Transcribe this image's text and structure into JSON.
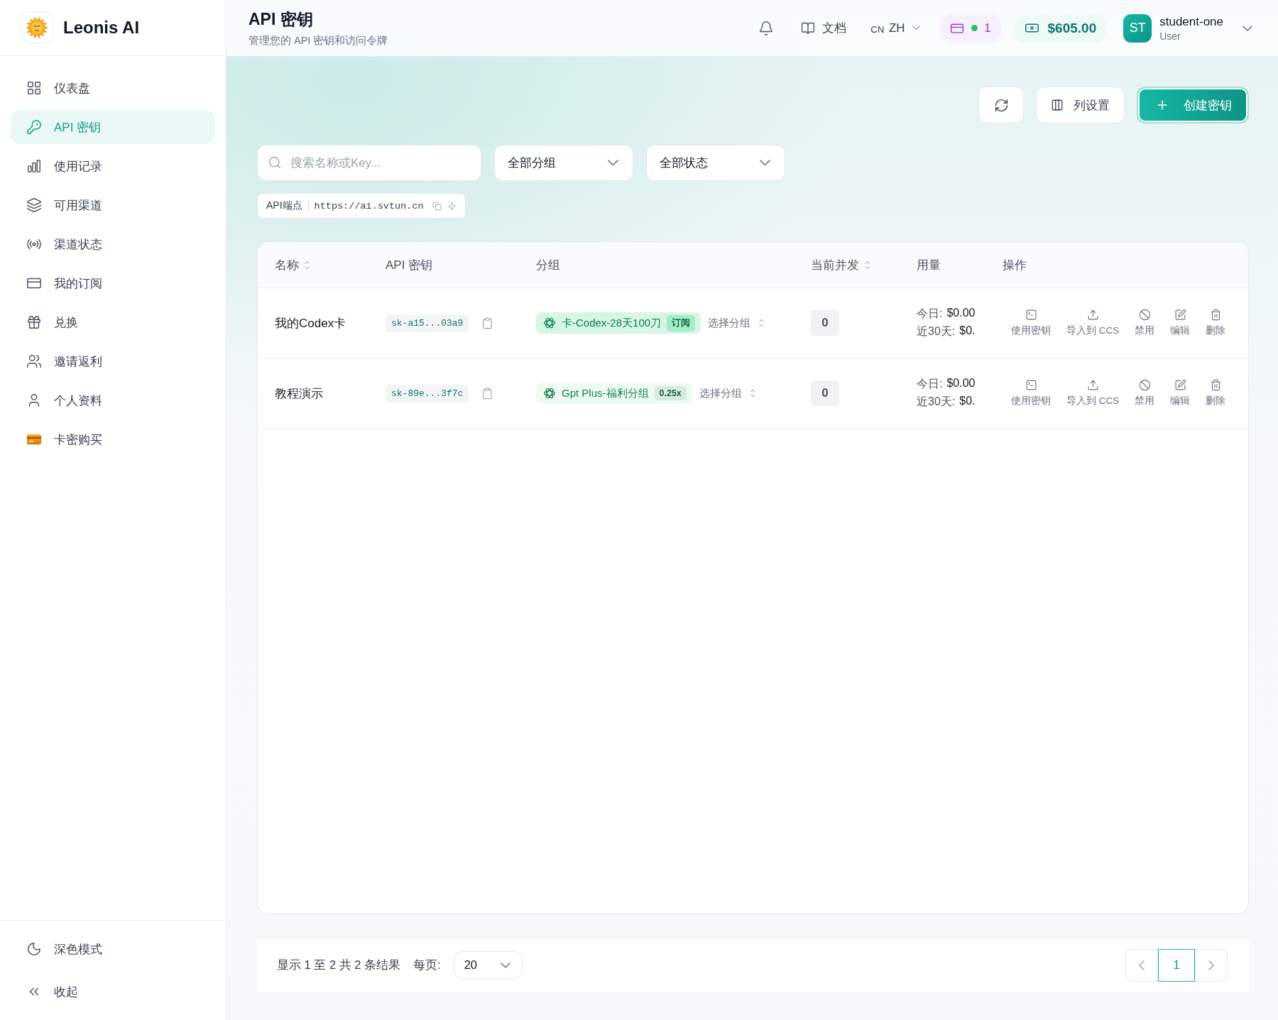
{
  "brand": {
    "name": "Leonis AI"
  },
  "sidebar": {
    "items": [
      {
        "label": "仪表盘",
        "selected": false
      },
      {
        "label": "API 密钥",
        "selected": true
      },
      {
        "label": "使用记录",
        "selected": false
      },
      {
        "label": "可用渠道",
        "selected": false
      },
      {
        "label": "渠道状态",
        "selected": false
      },
      {
        "label": "我的订阅",
        "selected": false
      },
      {
        "label": "兑换",
        "selected": false
      },
      {
        "label": "邀请返利",
        "selected": false
      },
      {
        "label": "个人资料",
        "selected": false
      },
      {
        "label": "卡密购买",
        "selected": false
      }
    ],
    "footer_items": [
      {
        "label": "深色模式"
      },
      {
        "label": "收起"
      }
    ]
  },
  "header": {
    "title": "API 密钥",
    "subtitle": "管理您的 API 密钥和访问令牌",
    "docs": "文档",
    "language": {
      "region": "CN",
      "code": "ZH"
    },
    "subscriptions": "1",
    "balance": "$605.00",
    "user": {
      "initials": "ST",
      "name": "student-one",
      "role": "User"
    }
  },
  "toolbar": {
    "columns_button": "列设置",
    "create_button": "创建密钥"
  },
  "filters": {
    "search": {
      "placeholder": "搜索名称或Key..."
    },
    "group": "全部分组",
    "status": "全部状态"
  },
  "endpoint": {
    "label": "API端点",
    "url": "https://ai.svtun.cn"
  },
  "table": {
    "columns": [
      {
        "label": "名称",
        "sortable": true
      },
      {
        "label": "API 密钥",
        "sortable": false
      },
      {
        "label": "分组",
        "sortable": false
      },
      {
        "label": "当前并发",
        "sortable": true
      },
      {
        "label": "用量",
        "sortable": false
      },
      {
        "label": "操作",
        "sortable": false
      }
    ],
    "rows": [
      {
        "name": "我的Codex卡",
        "key": "sk-a15...03a9",
        "group": {
          "kind": "subscription",
          "name": "卡-Codex-28天100刀",
          "badge": "订阅"
        },
        "group_select": "选择分组",
        "concurrency": "0",
        "usage": [
          {
            "label": "今日:",
            "value": "$0.00"
          },
          {
            "label": "近30天:",
            "value": "$0."
          }
        ],
        "actions": [
          "使用密钥",
          "导入到 CCS",
          "禁用",
          "编辑",
          "删除"
        ]
      },
      {
        "name": "教程演示",
        "key": "sk-89e...3f7c",
        "group": {
          "kind": "rate",
          "name": "Gpt Plus-福利分组",
          "badge": "0.25x"
        },
        "group_select": "选择分组",
        "concurrency": "0",
        "usage": [
          {
            "label": "今日:",
            "value": "$0.00"
          },
          {
            "label": "近30天:",
            "value": "$0."
          }
        ],
        "actions": [
          "使用密钥",
          "导入到 CCS",
          "禁用",
          "编辑",
          "删除"
        ]
      }
    ]
  },
  "pagination": {
    "summary": "显示 1 至 2 共 2 条结果",
    "page_size_label": "每页:",
    "page_size": "20",
    "pages": [
      {
        "label": "1",
        "selected": true
      }
    ]
  }
}
